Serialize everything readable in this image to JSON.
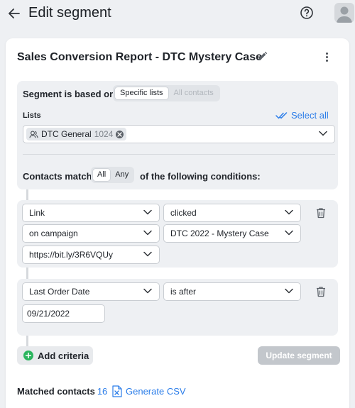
{
  "header": {
    "title": "Edit segment"
  },
  "segment": {
    "name": "Sales Conversion Report - DTC Mystery Case"
  },
  "based_on": {
    "label": "Segment is based on",
    "options": [
      "Specific lists",
      "All contacts"
    ],
    "selected": "Specific lists"
  },
  "lists": {
    "label": "Lists",
    "select_all_label": "Select all",
    "chips": [
      {
        "name": "DTC General",
        "count": "1024"
      }
    ]
  },
  "match": {
    "prefix": "Contacts match",
    "options": [
      "All",
      "Any"
    ],
    "selected": "All",
    "suffix": "of the following conditions:"
  },
  "conditions": [
    {
      "field": "Link",
      "operator": "clicked",
      "scope": "on campaign",
      "campaign": "DTC 2022 - Mystery Case",
      "value": "https://bit.ly/3R6VQUy"
    },
    {
      "field": "Last Order Date",
      "operator": "is after",
      "value": "09/21/2022"
    }
  ],
  "actions": {
    "add_criteria": "Add criteria",
    "update_segment": "Update segment"
  },
  "footer": {
    "matched_label": "Matched contacts",
    "matched_count": "16",
    "generate_csv": "Generate CSV"
  },
  "colors": {
    "accent": "#2b7de9",
    "add_green": "#2bb55e",
    "panel_bg": "#eef0f3"
  }
}
